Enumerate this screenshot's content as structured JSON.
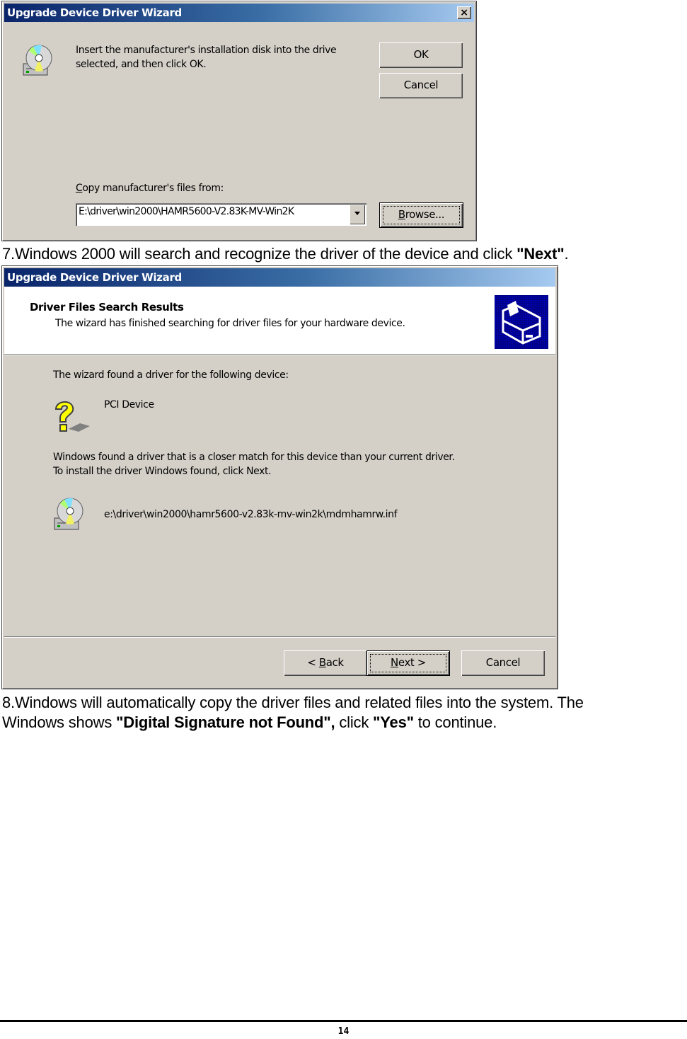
{
  "dialog1": {
    "title": "Upgrade Device Driver Wizard",
    "close_label": "×",
    "message_line1": "Insert the manufacturer's installation disk into the drive",
    "message_line2": "selected, and then click OK.",
    "ok_label": "OK",
    "cancel_label": "Cancel",
    "copy_label_prefix": "C",
    "copy_label_rest": "opy manufacturer's files from:",
    "path_value": "E:\\driver\\win2000\\HAMR5600-V2.83K-MV-Win2K",
    "browse_prefix": "B",
    "browse_rest": "rowse..."
  },
  "step7": {
    "text": "7.Windows 2000 will search and recognize the driver of the device and click ",
    "bold": "\"Next\"",
    "tail": "."
  },
  "dialog2": {
    "title": "Upgrade Device Driver Wizard",
    "header_title": "Driver Files Search Results",
    "header_subtitle": "The wizard has finished searching for driver files for your hardware device.",
    "found_label": "The wizard found a driver for the following device:",
    "device_name": "PCI Device",
    "match_line1": "Windows found a driver that is a closer match for this device than your current driver.",
    "match_line2": "To install the driver Windows found, click Next.",
    "inf_path": "e:\\driver\\win2000\\hamr5600-v2.83k-mv-win2k\\mdmhamrw.inf",
    "back_prefix": "< ",
    "back_key": "B",
    "back_rest": "ack",
    "next_key": "N",
    "next_rest": "ext >",
    "cancel_label": "Cancel"
  },
  "step8": {
    "line1": "8.Windows will automatically copy the driver files and related files into the system. The",
    "line2_a": "Windows shows ",
    "line2_b": "\"Digital Signature not Found\",",
    "line2_c": " click ",
    "line2_d": "\"Yes\"",
    "line2_e": " to continue."
  },
  "footer": {
    "page_number": "14"
  }
}
